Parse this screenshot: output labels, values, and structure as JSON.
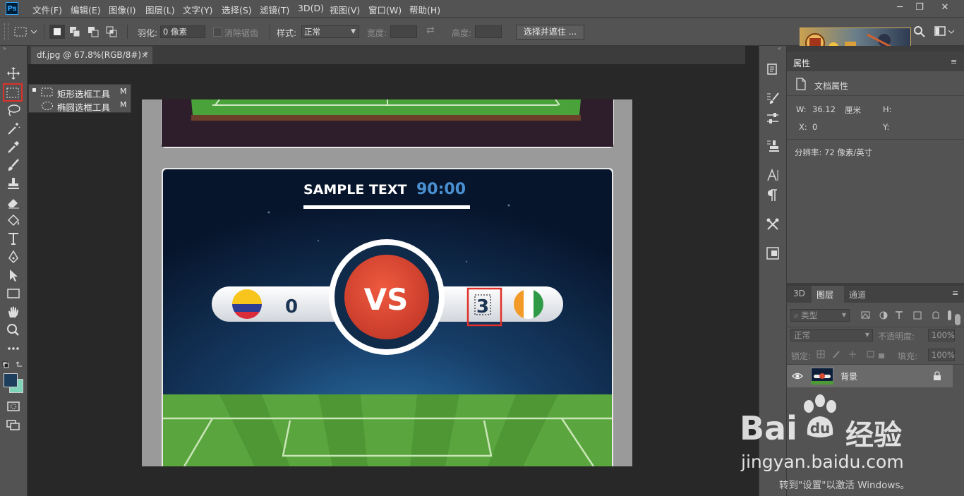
{
  "app": {
    "logo": "Ps"
  },
  "menu": [
    "文件(F)",
    "编辑(E)",
    "图像(I)",
    "图层(L)",
    "文字(Y)",
    "选择(S)",
    "滤镜(T)",
    "3D(D)",
    "视图(V)",
    "窗口(W)",
    "帮助(H)"
  ],
  "window_controls": {
    "minimize": "─",
    "restore": "❐",
    "close": "✕"
  },
  "options": {
    "feather_label": "羽化:",
    "feather_value": "0 像素",
    "antialias_label": "消除锯齿",
    "style_label": "样式:",
    "style_value": "正常",
    "width_label": "宽度:",
    "height_label": "高度:",
    "select_mask_button": "选择并遮住 ..."
  },
  "flyout": {
    "items": [
      {
        "label": "矩形选框工具",
        "shortcut": "M"
      },
      {
        "label": "椭圆选框工具",
        "shortcut": "M"
      }
    ]
  },
  "document": {
    "tab_title": "df.jpg @ 67.8%(RGB/8#) *",
    "close": "×",
    "banner_text": "SAMPLE TEXT",
    "banner_time": "90:00",
    "vs_text": "VS",
    "score_left": "0",
    "score_right": "3"
  },
  "properties": {
    "tab": "属性",
    "section": "文档属性",
    "w_label": "W:",
    "w_value": "36.12",
    "w_unit": "厘米",
    "h_label": "H:",
    "x_label": "X:",
    "x_value": "0",
    "y_label": "Y:",
    "resolution": "分辨率: 72 像素/英寸"
  },
  "layers": {
    "tabs": [
      "3D",
      "图层",
      "通道"
    ],
    "filter_placeholder": "类型",
    "blend_mode": "正常",
    "opacity_label": "不透明度:",
    "opacity_value": "100%",
    "lock_label": "锁定:",
    "fill_label": "填充:",
    "fill_value": "100%",
    "layer_name": "背景"
  },
  "watermark": {
    "brand": "Bai",
    "brand_cn": "经验",
    "url": "jingyan.baidu.com",
    "activation": "转到\"设置\"以激活 Windows。"
  },
  "colors": {
    "ui_bg": "#535353",
    "accent_red": "#e0302a",
    "foreground_swatch": "#1d3e5c",
    "background_swatch": "#7fd3b8"
  }
}
